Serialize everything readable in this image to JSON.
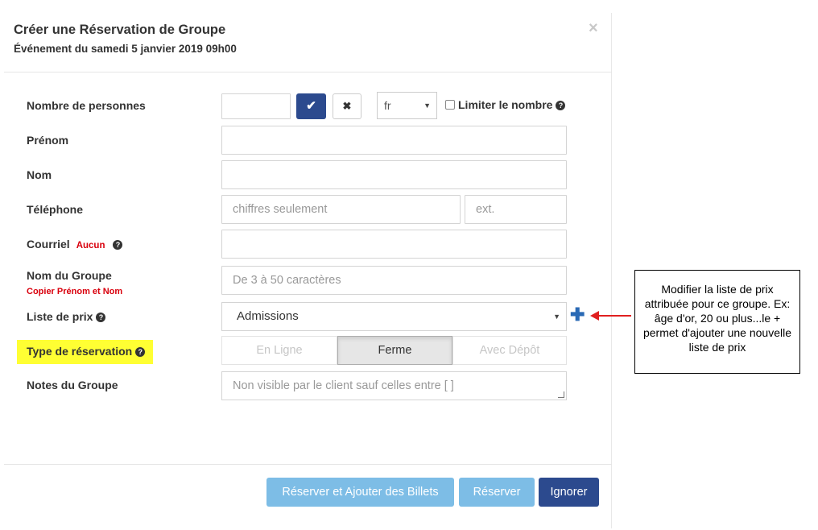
{
  "modal": {
    "title": "Créer une Réservation de Groupe",
    "subtitle": "Événement du samedi 5 janvier 2019 09h00",
    "close_glyph": "×"
  },
  "form": {
    "nombre_personnes": {
      "label": "Nombre de personnes",
      "value": "",
      "confirm_icon": "check-icon",
      "clear_icon": "times-icon"
    },
    "langue": {
      "selected": "fr"
    },
    "limiter": {
      "label": "Limiter le nombre",
      "checked": false
    },
    "prenom": {
      "label": "Prénom",
      "value": ""
    },
    "nom": {
      "label": "Nom",
      "value": ""
    },
    "telephone": {
      "label": "Téléphone",
      "placeholder": "chiffres seulement",
      "ext_placeholder": "ext."
    },
    "courriel": {
      "label": "Courriel",
      "note": "Aucun",
      "value": ""
    },
    "nom_groupe": {
      "label": "Nom du Groupe",
      "link": "Copier Prénom et Nom",
      "placeholder": "De 3 à 50 caractères"
    },
    "liste_prix": {
      "label": "Liste de prix",
      "selected": "Admissions",
      "add_icon": "plus-icon"
    },
    "type_reservation": {
      "label": "Type de réservation",
      "options": [
        "En Ligne",
        "Ferme",
        "Avec Dépôt"
      ],
      "selected": "Ferme"
    },
    "notes": {
      "label": "Notes du Groupe",
      "placeholder": "Non visible par le client sauf celles entre [ ]"
    }
  },
  "footer": {
    "reserve_add_tickets": "Réserver et Ajouter des Billets",
    "reserve": "Réserver",
    "ignore": "Ignorer"
  },
  "annotation": {
    "text": "Modifier la liste de prix attribuée pour ce groupe. Ex: âge d'or, 20 ou plus...le + permet d'ajouter une nouvelle liste de prix"
  },
  "colors": {
    "primary": "#2c4a8e",
    "primary_light": "#7dbde6",
    "highlight": "#ffff33",
    "danger": "#d9000d",
    "annotation_arrow": "#e02020"
  }
}
